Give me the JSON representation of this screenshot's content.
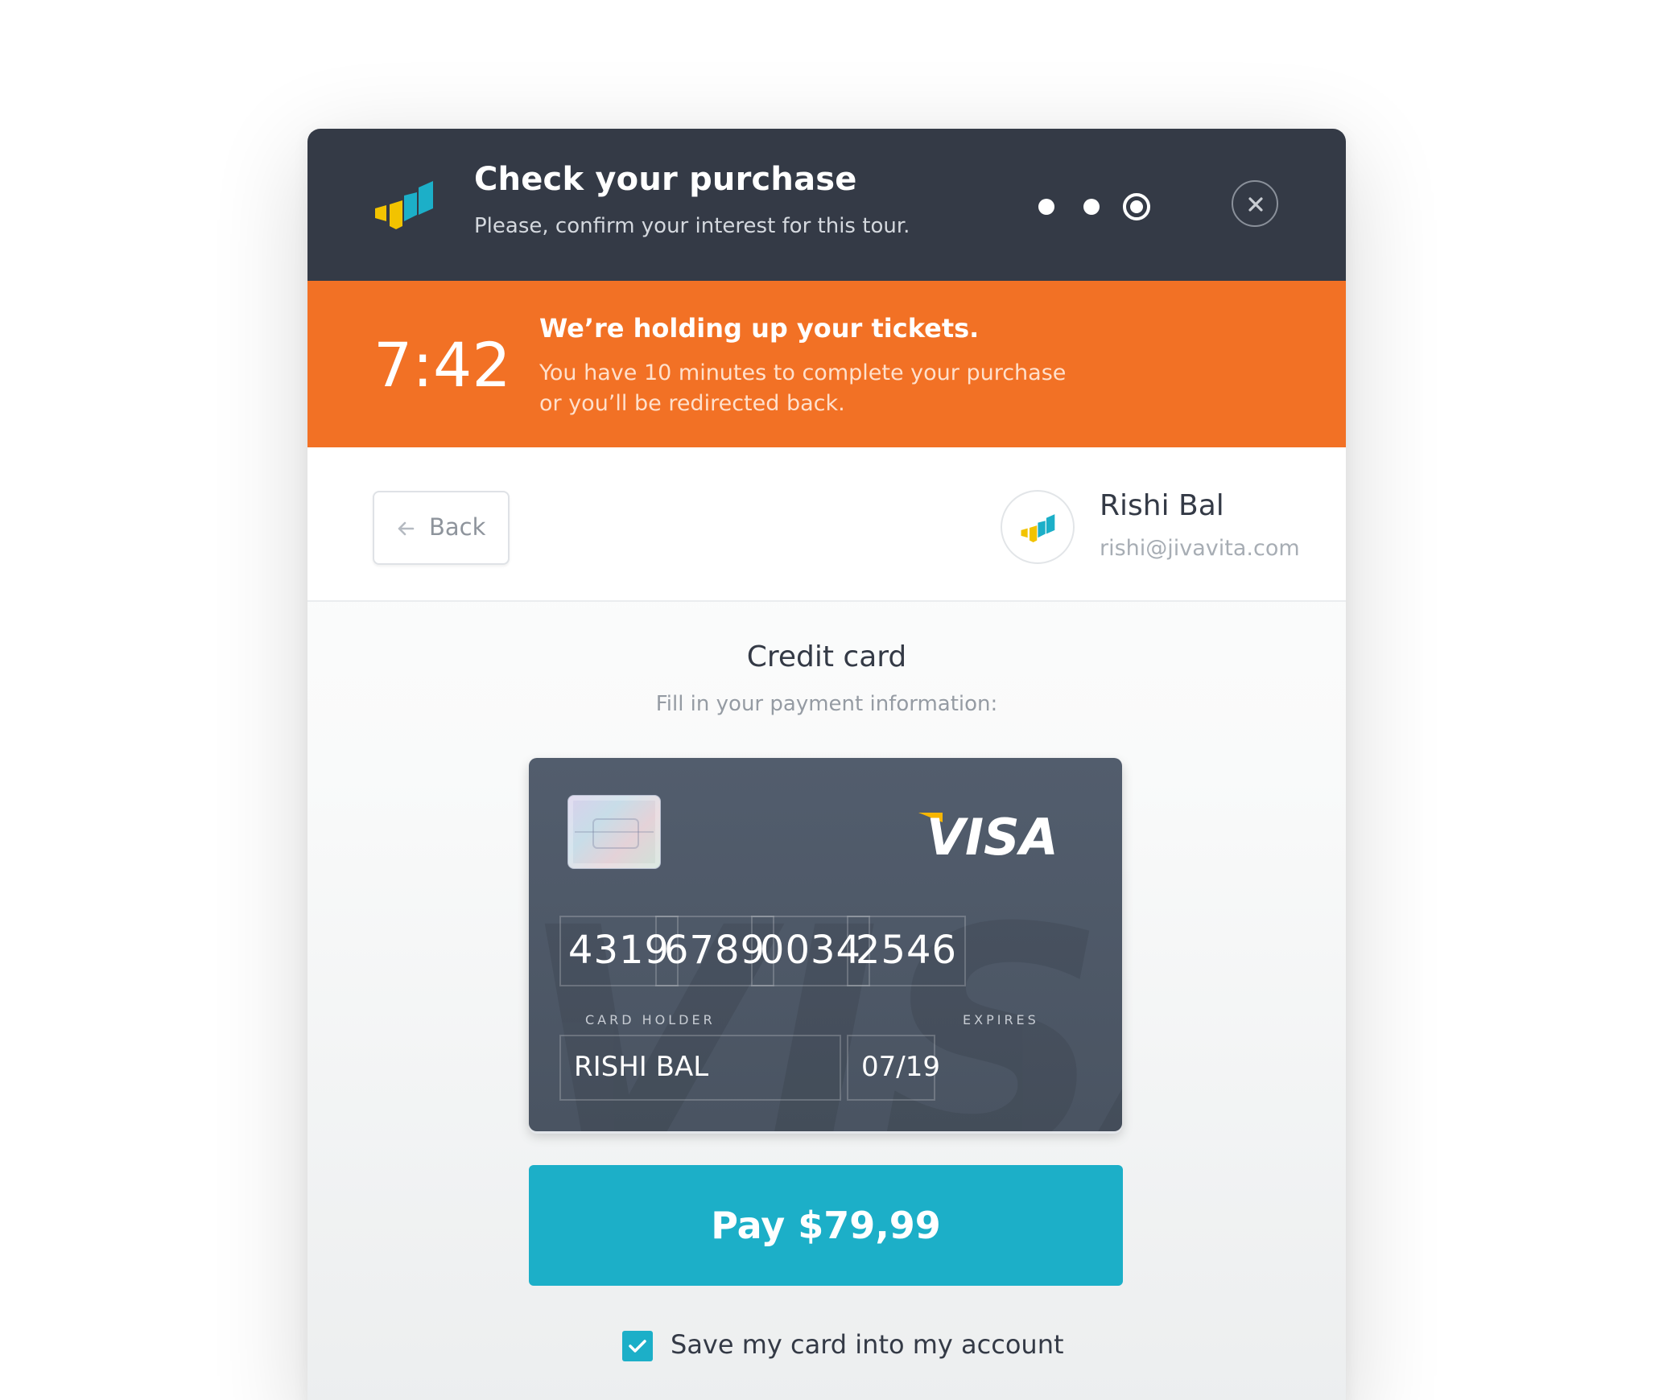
{
  "header": {
    "title": "Check your purchase",
    "subtitle": "Please, confirm your interest for this tour.",
    "steps_total": 3,
    "active_step": 3,
    "logo_icon": "bar-chart-logo-icon",
    "close_icon": "close-icon"
  },
  "timer": {
    "value": "7:42",
    "title": "We’re holding up your tickets.",
    "message": "You have 10 minutes to complete your purchase or you’ll be redirected back."
  },
  "nav": {
    "back_label": "Back",
    "back_icon": "arrow-left-icon"
  },
  "user": {
    "name": "Rishi Bal",
    "email": "rishi@jivavita.com"
  },
  "payment": {
    "title": "Credit card",
    "subtitle": "Fill in your payment information:",
    "card": {
      "brand": "VISA",
      "number_groups": [
        "4319",
        "6789",
        "0034",
        "2546"
      ],
      "holder_label": "CARD HOLDER",
      "holder": "RISHI BAL",
      "expires_label": "EXPIRES",
      "expires": "07/19"
    },
    "pay_label": "Pay $79,99",
    "save_card_label": "Save my card into my account",
    "save_card_checked": true
  },
  "colors": {
    "header_bg": "#343a46",
    "timer_bg": "#f27125",
    "accent": "#1cafc8",
    "card_bg": "#4e5968"
  }
}
